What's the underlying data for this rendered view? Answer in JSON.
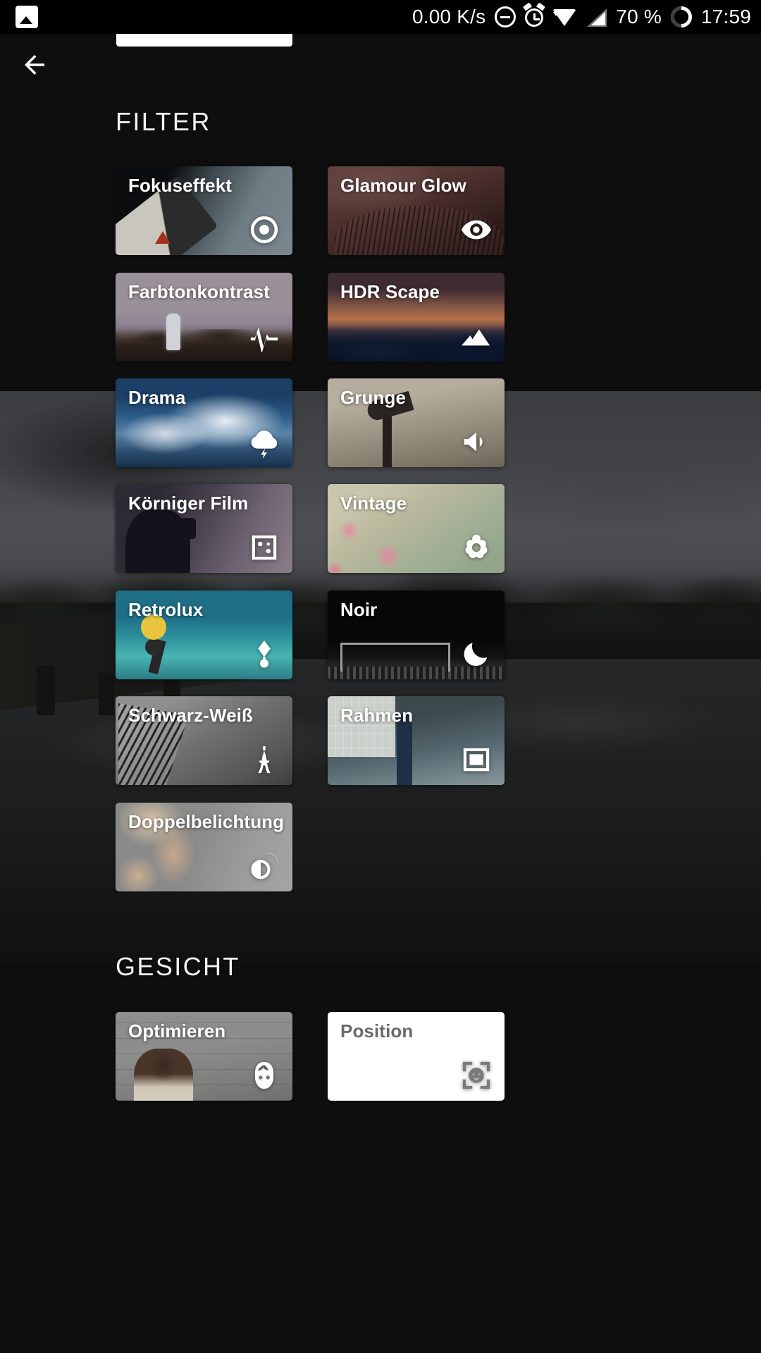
{
  "statusbar": {
    "network_speed": "0.00 K/s",
    "battery_percent": "70 %",
    "clock": "17:59",
    "icons": [
      "gallery-icon",
      "dnd-icon",
      "alarm-icon",
      "wifi-icon",
      "signal-icon",
      "battery-icon"
    ]
  },
  "nav": {
    "back_label": "back-arrow-icon"
  },
  "sections": [
    {
      "id": "filter",
      "title": "FILTER",
      "cards": [
        {
          "label": "Fokuseffekt",
          "icon": "lens-blur-icon",
          "thumb": "t-fokus"
        },
        {
          "label": "Glamour Glow",
          "icon": "eye-icon",
          "thumb": "t-glamour"
        },
        {
          "label": "Farbtonkontrast",
          "icon": "waveform-icon",
          "thumb": "t-farbton"
        },
        {
          "label": "HDR Scape",
          "icon": "mountains-icon",
          "thumb": "t-hdr"
        },
        {
          "label": "Drama",
          "icon": "storm-cloud-icon",
          "thumb": "t-drama"
        },
        {
          "label": "Grunge",
          "icon": "megaphone-icon",
          "thumb": "t-grunge"
        },
        {
          "label": "Körniger Film",
          "icon": "grain-square-icon",
          "thumb": "t-koernig"
        },
        {
          "label": "Vintage",
          "icon": "flower-icon",
          "thumb": "t-vintage"
        },
        {
          "label": "Retrolux",
          "icon": "light-leak-icon",
          "thumb": "t-retro"
        },
        {
          "label": "Noir",
          "icon": "moon-icon",
          "thumb": "t-noir"
        },
        {
          "label": "Schwarz-Weiß",
          "icon": "eiffel-tower-icon",
          "thumb": "t-sw"
        },
        {
          "label": "Rahmen",
          "icon": "frame-icon",
          "thumb": "t-rahmen"
        },
        {
          "label": "Doppelbelichtung",
          "icon": "double-exposure-icon",
          "thumb": "t-doppel"
        }
      ]
    },
    {
      "id": "gesicht",
      "title": "GESICHT",
      "cards": [
        {
          "label": "Optimieren",
          "icon": "face-icon",
          "thumb": "t-optimieren",
          "style": "dark"
        },
        {
          "label": "Position",
          "icon": "face-position-icon",
          "thumb": "t-position",
          "style": "light"
        }
      ]
    }
  ],
  "colors": {
    "page_background": "#0e0e0e",
    "statusbar_background": "#000000",
    "heading_text": "#f2f2f2",
    "card_label_text": "#ffffff",
    "light_card_background": "#ffffff",
    "light_card_text": "#6a6a6a"
  }
}
